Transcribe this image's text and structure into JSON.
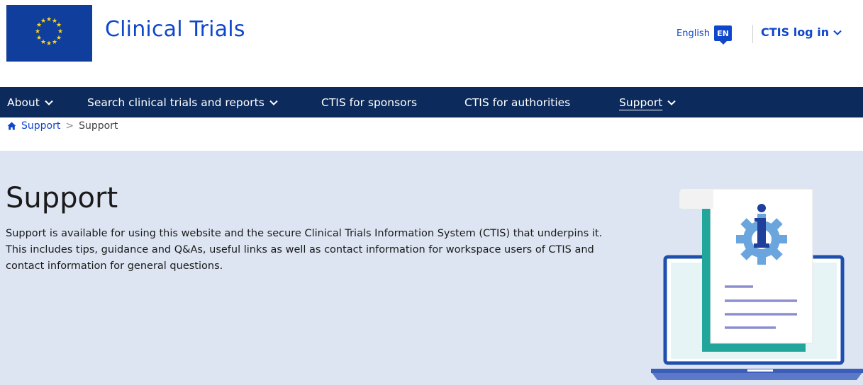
{
  "header": {
    "site_title": "Clinical Trials",
    "language_label": "English",
    "language_code": "EN",
    "login_label": "CTIS log in"
  },
  "nav": {
    "items": [
      {
        "label": "About",
        "has_dropdown": true
      },
      {
        "label": "Search clinical trials and reports",
        "has_dropdown": true
      },
      {
        "label": "CTIS for sponsors",
        "has_dropdown": false
      },
      {
        "label": "CTIS for authorities",
        "has_dropdown": false
      },
      {
        "label": "Support",
        "has_dropdown": true,
        "active": true
      }
    ]
  },
  "breadcrumb": {
    "parent": "Support",
    "separator": ">",
    "current": "Support"
  },
  "hero": {
    "title": "Support",
    "description": "Support is available for using this website and the secure Clinical Trials Information System (CTIS) that underpins it. This includes tips, guidance and Q&As, useful links as well as contact information for workspace users of CTIS and contact information for general questions."
  },
  "colors": {
    "brand_blue": "#0e47cb",
    "nav_bg": "#0c2a5b",
    "hero_bg": "#dde5f2",
    "eu_flag_blue": "#0f3e9d",
    "eu_star": "#ffd617"
  },
  "icons": [
    "eu-flag-logo",
    "chevron-down-icon",
    "home-icon",
    "info-document-illustration"
  ]
}
